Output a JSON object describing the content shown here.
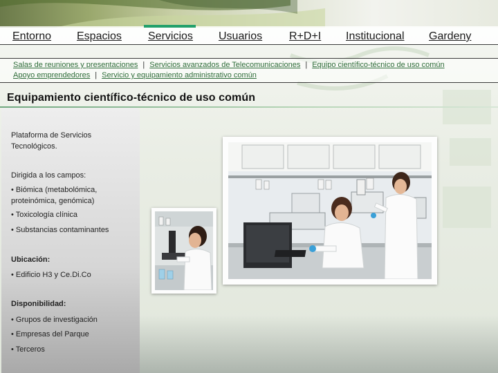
{
  "nav": {
    "items": [
      {
        "label": "Entorno"
      },
      {
        "label": "Espacios"
      },
      {
        "label": "Servicios",
        "active": true
      },
      {
        "label": "Usuarios"
      },
      {
        "label": "R+D+I"
      },
      {
        "label": "Institucional"
      },
      {
        "label": "Gardeny"
      }
    ]
  },
  "subnav": {
    "row1": [
      {
        "label": "Salas de reuniones y presentaciones"
      },
      {
        "label": "Servicios avanzados de Telecomunicaciones"
      },
      {
        "label": "Equipo científico-técnico de uso común"
      }
    ],
    "row2": [
      {
        "label": "Apoyo emprendedores"
      },
      {
        "label": "Servicio y equipamiento administrativo común"
      }
    ],
    "separator": "|"
  },
  "page": {
    "title": "Equipamiento científico-técnico de uso común"
  },
  "panel": {
    "intro": "Plataforma de Servicios Tecnológicos.",
    "fields_label": "Dirigida a los campos:",
    "fields": [
      "• Biómica (metabolómica, proteinómica, genómica)",
      "• Toxicología clínica",
      "• Substancias contaminantes"
    ],
    "location_heading": "Ubicación:",
    "location": "• Edificio H3 y Ce.Di.Co",
    "availability_heading": "Disponibilidad:",
    "availability": [
      "• Grupos de investigación",
      "• Empresas del Parque",
      "• Terceros"
    ]
  },
  "colors": {
    "accent": "#22a06b",
    "link": "#2f6d3a",
    "text": "#1a1a1a"
  }
}
